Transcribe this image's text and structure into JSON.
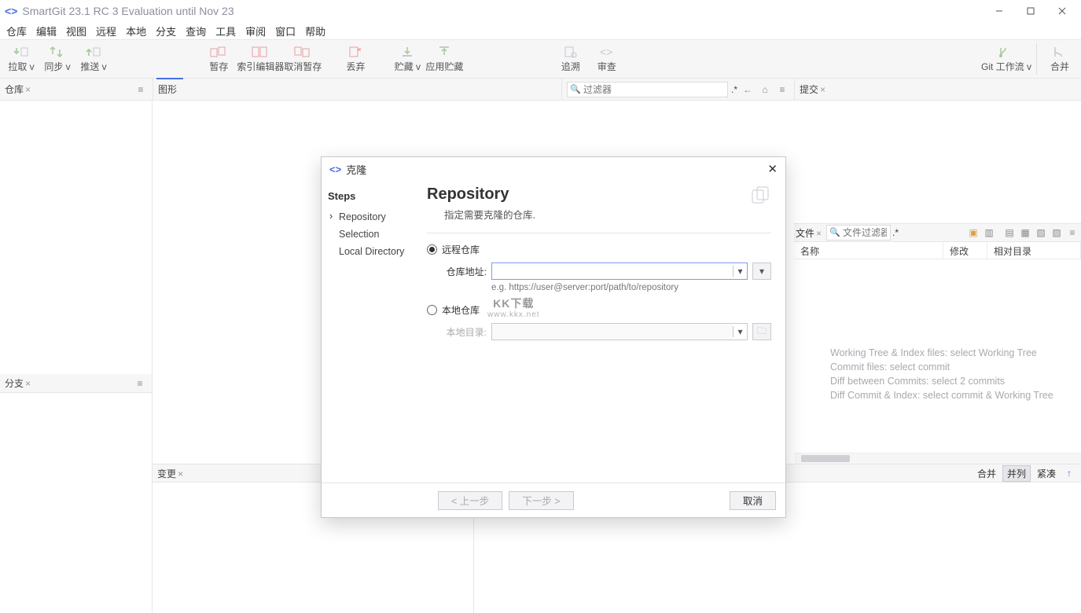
{
  "window": {
    "title": "SmartGit 23.1 RC 3 Evaluation until Nov 23"
  },
  "menu": [
    "仓库",
    "编辑",
    "视图",
    "远程",
    "本地",
    "分支",
    "查询",
    "工具",
    "审阅",
    "窗口",
    "帮助"
  ],
  "toolbar": {
    "pull": "拉取 v",
    "sync": "同步 v",
    "push": "推送 v",
    "stage": "暂存",
    "indexEditor": "索引编辑器",
    "unstage": "取消暂存",
    "discard": "丢弃",
    "stash": "贮藏 v",
    "applyStash": "应用贮藏",
    "blame": "追溯",
    "review": "审查",
    "gitFlow": "Git 工作流 v",
    "merge": "合并"
  },
  "col": {
    "repo": "仓库",
    "graph": "图形",
    "filterPlaceholder": "过滤器",
    "star": ".*",
    "commit": "提交",
    "branches": "分支",
    "changes": "变更",
    "files": "文件",
    "fileFilterPlaceholder": "文件过滤器"
  },
  "fileTable": {
    "name": "名称",
    "mod": "修改",
    "rel": "相对目录"
  },
  "help": {
    "l1": "Working Tree & Index files: select Working Tree",
    "l2": "Commit files: select commit",
    "l3": "Diff between Commits: select 2 commits",
    "l4": "Diff Commit & Index: select commit & Working Tree"
  },
  "bottomToggles": {
    "merge": "合并",
    "sideBySide": "并列",
    "compact": "紧凑"
  },
  "dialog": {
    "title": "克隆",
    "stepsHeading": "Steps",
    "steps": {
      "repository": "Repository",
      "selection": "Selection",
      "localDirectory": "Local Directory"
    },
    "heading": "Repository",
    "subtitle": "指定需要克隆的仓库.",
    "optRemote": "远程仓库",
    "optLocal": "本地仓库",
    "labelRepoUrl": "仓库地址:",
    "labelLocalDir": "本地目录:",
    "urlHint": "e.g. https://user@server:port/path/to/repository",
    "back": "< 上一步",
    "next": "下一步 >",
    "cancel": "取消"
  },
  "watermark": {
    "line1": "KK下载",
    "line2": "www.kkx.net"
  }
}
